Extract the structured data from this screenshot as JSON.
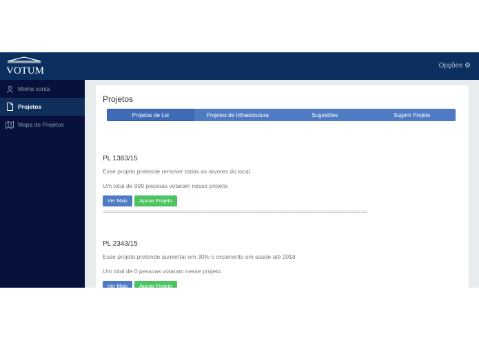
{
  "header": {
    "logo_text": "VOTUM",
    "options_label": "Opções",
    "options_icon": "gear-icon"
  },
  "sidebar": {
    "items": [
      {
        "label": "Minha conta",
        "icon": "user-icon",
        "active": false
      },
      {
        "label": "Projetos",
        "icon": "file-icon",
        "active": true
      },
      {
        "label": "Mapa de Projetos",
        "icon": "map-icon",
        "active": false
      }
    ]
  },
  "main": {
    "title": "Projetos",
    "tabs": [
      {
        "label": "Projetos de Lei",
        "active": true
      },
      {
        "label": "Projetos de Infraestrutura",
        "active": false
      },
      {
        "label": "Sugestões",
        "active": false
      },
      {
        "label": "Sugerir Projeto",
        "active": false
      }
    ],
    "projects": [
      {
        "title": "PL 1383/15",
        "description": "Esse projeto pretende remover todas as arvores do local.",
        "votes": "Um total de 999 pessoas votaram nesse projeto.",
        "view_label": "Ver Mais",
        "support_label": "Apoiar Projeto"
      },
      {
        "title": "PL 2343/15",
        "description": "Esse projeto pretende aumentar em 30% o orçamento em saude até 2018",
        "votes": "Um total de 0 pessoas votaram nesse projeto.",
        "view_label": "Ver Mais",
        "support_label": "Apoiar Projeto"
      }
    ],
    "divider": "============================================================================================"
  },
  "colors": {
    "header": "#0b3060",
    "sidebar": "#07123c",
    "accent": "#4f7bc5",
    "support": "#4cc464"
  }
}
